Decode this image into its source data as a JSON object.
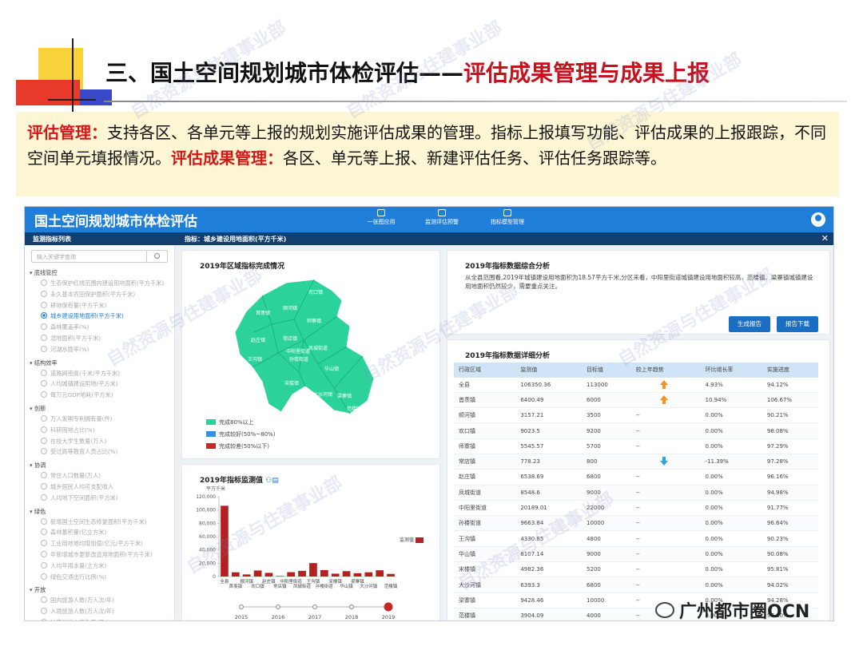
{
  "slide": {
    "title_prefix": "三、国土空间规划城市体检评估——",
    "title_emph": "评估成果管理与成果上报"
  },
  "desc": {
    "hl1": "评估管理：",
    "t1": "支持各区、各单元等上报的规划实施评估成果的管理。指标上报填写功能、评估成果的上报跟踪，不同空间单元填报情况。",
    "hl2": "评估成果管理：",
    "t2": "各区、单元等上报、新建评估任务、评估任务跟踪等。"
  },
  "app": {
    "title": "国土空间规划城市体检评估",
    "nav": [
      {
        "label": "一张图应用",
        "icon": "monitor-icon"
      },
      {
        "label": "监测评估预警",
        "icon": "chart-icon"
      },
      {
        "label": "指标模型管理",
        "icon": "book-icon"
      }
    ],
    "bar": {
      "left": "监测指标列表",
      "right": "指标：城乡建设用地面积(平方千米)"
    },
    "search_placeholder": "输入关键字查询",
    "tree": [
      {
        "group": "底线管控",
        "items": [
          "生态保护红线范围内建设用地面积(平方千米)",
          "永久基本农田保护面积(平方千米)",
          "耕地保有量(平方千米)",
          "城乡建设用地面积(平方千米)",
          "森林覆盖率(%)",
          "湿地面积(平方千米)",
          "河湖水面率(%)"
        ],
        "active": 3
      },
      {
        "group": "结构效率",
        "items": [
          "道路网密度(千米/平方千米)",
          "人均城镇建设用地(平方米)",
          "每万元GDP地耗(平方米)"
        ]
      },
      {
        "group": "创新",
        "items": [
          "万人发明专利拥有量(件)",
          "科研用地占比(%)",
          "在校大学生数量(万人)",
          "受过高等教育人员占比(%)"
        ]
      },
      {
        "group": "协调",
        "items": [
          "常住人口数量(万人)",
          "城乡居民人均可支配收入",
          "人均地下空间面积(平方米)"
        ]
      },
      {
        "group": "绿色",
        "items": [
          "新增国土空间生态修复面积(平方千米)",
          "森林蓄积量(亿立方米)",
          "工业用地地均增加值(亿元/平方千米)",
          "年新增城市更新改造用地面积(平方千米)",
          "人均年用水量(立方米)",
          "绿色交通出行比例(%)"
        ]
      },
      {
        "group": "开放",
        "items": [
          "国内旅游人数(万人次/年)",
          "入境旅游人数(万人次/年)",
          "外籍常住人口数量(万人)"
        ]
      }
    ],
    "map": {
      "title": "2019年区域指标完成情况",
      "regions": [
        "欢口镇",
        "首羡镇",
        "顺河镇",
        "师寨镇",
        "赵庄镇",
        "常店镇",
        "中阳里街道",
        "凤城街道",
        "孙楼街道",
        "王沟镇",
        "华山镇",
        "宋楼镇",
        "大沙河镇",
        "梁寨镇",
        "范楼镇"
      ],
      "legend": [
        {
          "label": "完成80%以上",
          "color": "#2bd39a"
        },
        {
          "label": "完成较好(50%~80%)",
          "color": "#3b8fe0"
        },
        {
          "label": "完成较差(50%以下)",
          "color": "#c62828"
        }
      ]
    },
    "summary": {
      "title": "2019年指标数据综合分析",
      "text": "从全县范围看,2019年城镇建设用地面积为18.57平方千米,分区来看，中阳里街道城镇建设用地面积较高，范楼镇、梁寨镇城镇建设用地面积仍然较少，需要重点关注。",
      "btn_report": "生成报告",
      "btn_download": "报告下载"
    },
    "detail": {
      "title": "2019年指标数据详细分析",
      "headers": [
        "行政区域",
        "监测值",
        "目标值",
        "较上年趋势",
        "环比增长率",
        "实施进度"
      ],
      "rows": [
        [
          "全县",
          "106350.36",
          "113000",
          "up",
          "4.93%",
          "94.12%"
        ],
        [
          "首羡镇",
          "6400.49",
          "6000",
          "up",
          "10.94%",
          "106.67%"
        ],
        [
          "顺河镇",
          "3157.21",
          "3500",
          "--",
          "0.00%",
          "90.21%"
        ],
        [
          "欢口镇",
          "9023.5",
          "9200",
          "--",
          "0.00%",
          "98.08%"
        ],
        [
          "师寨镇",
          "5545.57",
          "5700",
          "--",
          "0.00%",
          "97.29%"
        ],
        [
          "常店镇",
          "778.23",
          "800",
          "down",
          "-11.39%",
          "97.28%"
        ],
        [
          "赵庄镇",
          "6538.69",
          "6800",
          "--",
          "0.00%",
          "96.16%"
        ],
        [
          "凤城街道",
          "8548.6",
          "9000",
          "--",
          "0.00%",
          "94.98%"
        ],
        [
          "中阳里街道",
          "20189.01",
          "22000",
          "--",
          "0.00%",
          "91.77%"
        ],
        [
          "孙楼街道",
          "9663.84",
          "10000",
          "--",
          "0.00%",
          "96.64%"
        ],
        [
          "王沟镇",
          "4330.85",
          "4800",
          "--",
          "0.00%",
          "90.23%"
        ],
        [
          "华山镇",
          "8107.14",
          "9000",
          "--",
          "0.00%",
          "90.08%"
        ],
        [
          "宋楼镇",
          "4982.36",
          "5200",
          "--",
          "0.00%",
          "95.81%"
        ],
        [
          "大沙河镇",
          "6393.3",
          "6800",
          "--",
          "0.00%",
          "94.02%"
        ],
        [
          "梁寨镇",
          "9428.46",
          "10000",
          "--",
          "0.00%",
          "94.28%"
        ],
        [
          "范楼镇",
          "3904.09",
          "4000",
          "--",
          "0.00%",
          "97.60%"
        ]
      ]
    },
    "bar_chart": {
      "title": "2019年指标监测值",
      "unit": "平方千米",
      "yticks": [
        "0",
        "20,000",
        "40,000",
        "60,000",
        "80,000",
        "100,000",
        "120,000"
      ],
      "categories_top": [
        "全县",
        "顺河镇",
        "赵庄镇",
        "中阳里街道",
        "王沟镇",
        "宋楼镇",
        "梁寨镇"
      ],
      "categories_bot": [
        "首羡镇",
        "欢口镇",
        "常店镇",
        "凤城街道",
        "孙楼街道",
        "华山镇",
        "大沙河镇",
        "范楼镇"
      ],
      "legend": "监测值",
      "years": [
        "2015",
        "2016",
        "2017",
        "2018",
        "2019"
      ]
    }
  },
  "chart_data": {
    "type": "bar",
    "title": "2019年指标监测值",
    "ylabel": "平方千米",
    "categories": [
      "全县",
      "首羡镇",
      "顺河镇",
      "欢口镇",
      "师寨镇",
      "常店镇",
      "赵庄镇",
      "凤城街道",
      "中阳里街道",
      "孙楼街道",
      "王沟镇",
      "华山镇",
      "宋楼镇",
      "大沙河镇",
      "梁寨镇",
      "范楼镇"
    ],
    "values": [
      106350.36,
      6400.49,
      3157.21,
      9023.5,
      5545.57,
      778.23,
      6538.69,
      8548.6,
      20189.01,
      9663.84,
      4330.85,
      8107.14,
      4982.36,
      6393.3,
      9428.46,
      3904.09
    ],
    "ylim": [
      0,
      120000
    ],
    "series": [
      {
        "name": "监测值",
        "color": "#b22222"
      }
    ]
  },
  "footer": {
    "wechat": "广州都市圈OCN"
  },
  "watermarks": [
    "自然资源与住建事业部"
  ]
}
